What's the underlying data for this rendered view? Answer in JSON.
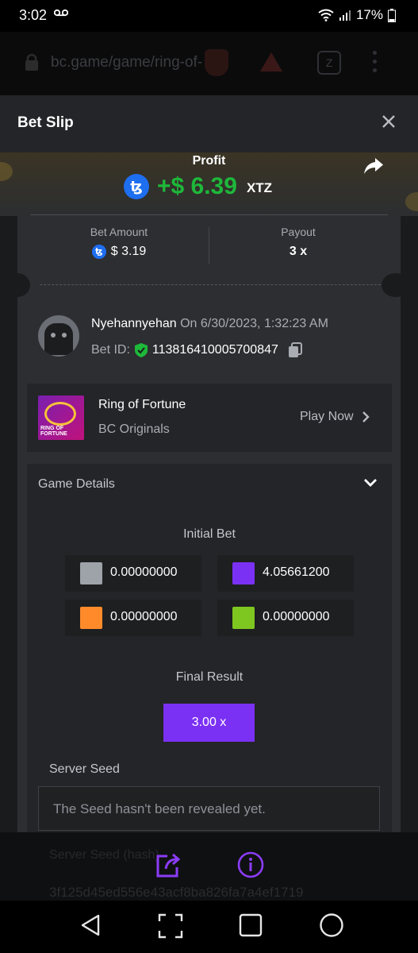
{
  "status_bar": {
    "time": "3:02",
    "battery": "17%"
  },
  "browser": {
    "url": "bc.game/game/ring-of-",
    "tab_count": "Z"
  },
  "bet_slip": {
    "title": "Bet Slip",
    "profit_label": "Profit",
    "profit_value": "+$ 6.39",
    "profit_currency": "XTZ",
    "coin_symbol": "ꜩ",
    "bet_amount_label": "Bet Amount",
    "bet_amount_value": "$ 3.19",
    "payout_label": "Payout",
    "payout_value": "3 x"
  },
  "user": {
    "username": "Nyehannyehan",
    "date_text": " On 6/30/2023, 1:32:23 AM",
    "bet_id_label": "Bet ID:",
    "bet_id_value": "113816410005700847"
  },
  "game": {
    "name": "Ring of Fortune",
    "provider": "BC Originals",
    "play_now": "Play Now",
    "thumb_text": "RING OF FORTUNE"
  },
  "details": {
    "title": "Game Details",
    "initial_bet_label": "Initial Bet",
    "bets": [
      {
        "color": "#9ea3aa",
        "value": "0.00000000"
      },
      {
        "color": "#7b31f4",
        "value": "4.05661200"
      },
      {
        "color": "#ff8a2a",
        "value": "0.00000000"
      },
      {
        "color": "#7ec620",
        "value": "0.00000000"
      }
    ],
    "final_result_label": "Final Result",
    "final_result_value": "3.00 x",
    "server_seed_label": "Server Seed",
    "server_seed_text": "The Seed hasn't been revealed yet."
  },
  "action_bar": {
    "hidden_label": "Server Seed (hash)",
    "hidden_hash": "3f125d45ed556e43acf8ba826fa7a4ef1719"
  },
  "colors": {
    "accent_purple": "#7b31f4",
    "profit_green": "#1eb83a",
    "coin_blue": "#1e6ef0"
  }
}
